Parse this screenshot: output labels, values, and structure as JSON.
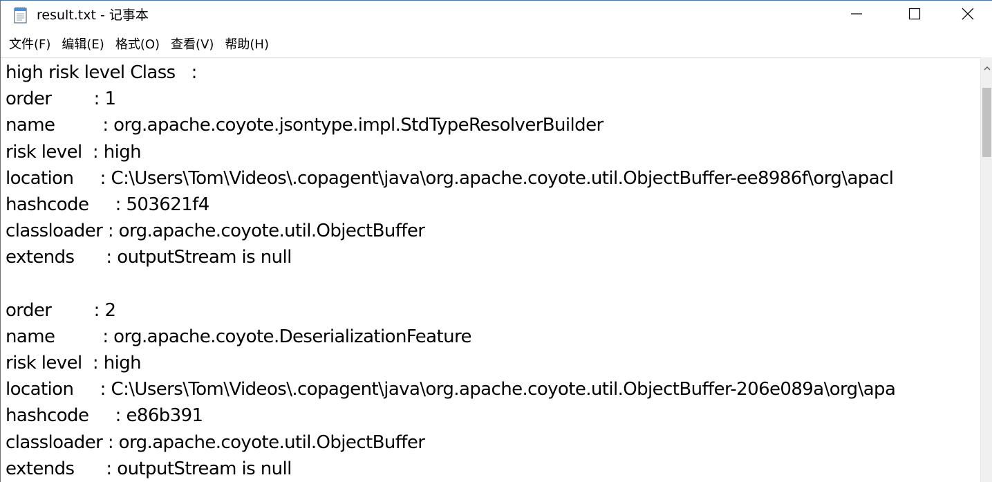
{
  "window": {
    "title": "result.txt - 记事本",
    "app_icon": "notepad-icon",
    "controls": {
      "minimize_icon": "minimize-icon",
      "maximize_icon": "maximize-icon",
      "close_icon": "close-icon"
    }
  },
  "menu": {
    "items": [
      {
        "label": "文件(F)"
      },
      {
        "label": "编辑(E)"
      },
      {
        "label": "格式(O)"
      },
      {
        "label": "查看(V)"
      },
      {
        "label": "帮助(H)"
      }
    ]
  },
  "editor": {
    "lines": [
      "high risk level Class   :",
      "order        : 1",
      "name         : org.apache.coyote.jsontype.impl.StdTypeResolverBuilder",
      "risk level  : high",
      "location     : C:\\Users\\Tom\\Videos\\.copagent\\java\\org.apache.coyote.util.ObjectBuffer-ee8986f\\org\\apacl",
      "hashcode     : 503621f4",
      "classloader : org.apache.coyote.util.ObjectBuffer",
      "extends      : outputStream is null",
      "",
      "order        : 2",
      "name         : org.apache.coyote.DeserializationFeature",
      "risk level  : high",
      "location     : C:\\Users\\Tom\\Videos\\.copagent\\java\\org.apache.coyote.util.ObjectBuffer-206e089a\\org\\apa",
      "hashcode     : e86b391",
      "classloader : org.apache.coyote.util.ObjectBuffer",
      "extends      : outputStream is null"
    ]
  },
  "scrollbar": {
    "up_icon": "chevron-up-icon"
  }
}
